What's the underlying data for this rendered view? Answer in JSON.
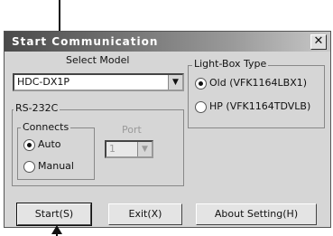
{
  "window": {
    "title": "Start Communication",
    "close_glyph": "✕"
  },
  "select_model": {
    "label": "Select Model",
    "value": "HDC-DX1P",
    "dropdown_glyph": "▼"
  },
  "light_box": {
    "label": "Light-Box Type",
    "options": [
      {
        "label": "Old (VFK1164LBX1)",
        "selected": true
      },
      {
        "label": "HP (VFK1164TDVLB)",
        "selected": false
      }
    ]
  },
  "rs232c": {
    "label": "RS-232C",
    "connects": {
      "label": "Connects",
      "options": [
        {
          "label": "Auto",
          "selected": true
        },
        {
          "label": "Manual",
          "selected": false
        }
      ]
    },
    "port": {
      "label": "Port",
      "value": "1",
      "dropdown_glyph": "▼"
    }
  },
  "buttons": {
    "start": "Start(S)",
    "exit": "Exit(X)",
    "about": "About Setting(H)"
  },
  "icons": {
    "arrow_top": "arrow-down-icon",
    "arrow_bottom": "arrow-up-icon"
  }
}
